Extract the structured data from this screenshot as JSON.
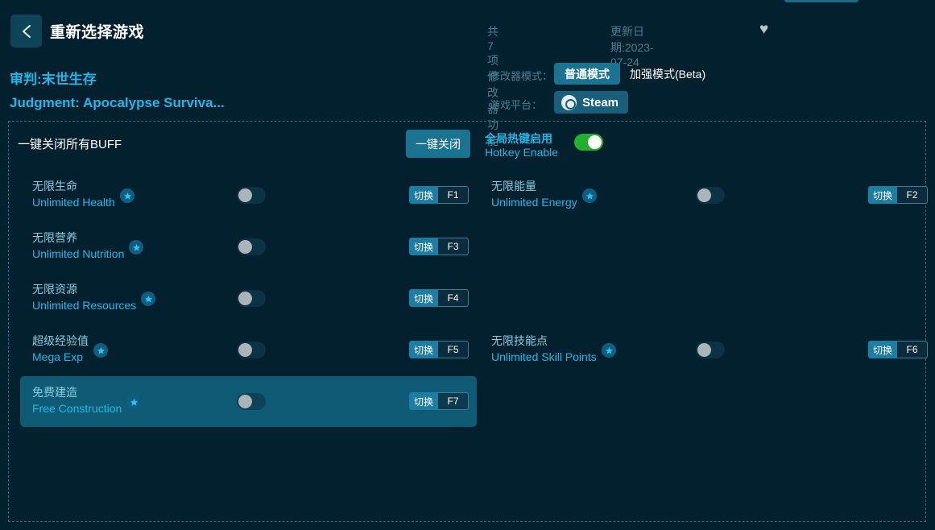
{
  "header": {
    "back_icon": "chevron-left-icon",
    "title": "重新选择游戏",
    "trainer_count": "共7项修改器功能",
    "update_date": "更新日期:2023-07-24",
    "favorite_icon": "heart-icon",
    "game_name_cn": "审判:末世生存",
    "game_name_en": "Judgment: Apocalypse Surviva...",
    "mode_label": "修改器模式：",
    "mode_normal": "普通模式",
    "mode_beta": "加强模式(Beta)",
    "platform_label": "游戏平台：",
    "platform_name": "Steam",
    "platform_icon": "steam-icon"
  },
  "buff_bar": {
    "label": "一键关闭所有BUFF",
    "close_all_label": "一键关闭",
    "hotkey_cn": "全局热键启用",
    "hotkey_en": "Hotkey Enable",
    "hotkey_state": "on"
  },
  "colors": {
    "page_bg": "#03202e",
    "accent": "#23b6e8",
    "button": "#1a7391",
    "selected_row": "#0f5a75",
    "toggle_on": "#21b02b",
    "muted_text": "#4e7e92"
  },
  "cheats": [
    {
      "cn": "无限生命",
      "en": "Unlimited Health",
      "star": true,
      "toggle": "off",
      "hotkey_action": "切换",
      "hotkey_key": "F1",
      "column": "left",
      "index": 0,
      "selected": false
    },
    {
      "cn": "无限能量",
      "en": "Unlimited Energy",
      "star": true,
      "toggle": "off",
      "hotkey_action": "切换",
      "hotkey_key": "F2",
      "column": "right",
      "index": 0,
      "selected": false
    },
    {
      "cn": "无限营养",
      "en": "Unlimited Nutrition",
      "star": true,
      "toggle": "off",
      "hotkey_action": "切换",
      "hotkey_key": "F3",
      "column": "left",
      "index": 1,
      "selected": false
    },
    {
      "cn": "无限资源",
      "en": "Unlimited Resources",
      "star": true,
      "toggle": "off",
      "hotkey_action": "切换",
      "hotkey_key": "F4",
      "column": "left",
      "index": 2,
      "selected": false
    },
    {
      "cn": "超级经验值",
      "en": "Mega Exp",
      "star": true,
      "toggle": "off",
      "hotkey_action": "切换",
      "hotkey_key": "F5",
      "column": "left",
      "index": 3,
      "selected": false
    },
    {
      "cn": "无限技能点",
      "en": "Unlimited Skill Points",
      "star": true,
      "toggle": "off",
      "hotkey_action": "切换",
      "hotkey_key": "F6",
      "column": "right",
      "index": 3,
      "selected": false
    },
    {
      "cn": "免费建造",
      "en": "Free Construction",
      "star": true,
      "toggle": "off",
      "hotkey_action": "切换",
      "hotkey_key": "F7",
      "column": "left",
      "index": 4,
      "selected": true
    }
  ]
}
